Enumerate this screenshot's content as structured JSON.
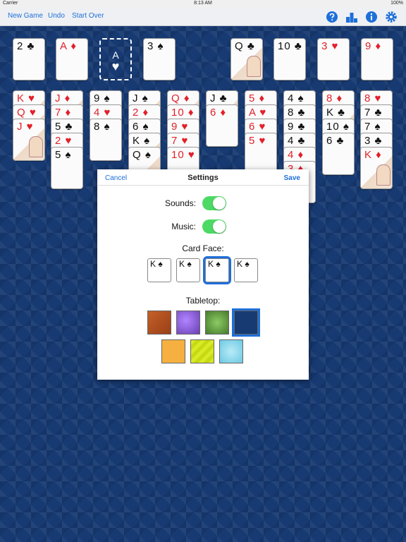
{
  "status": {
    "carrier": "Carrier",
    "time": "8:13 AM",
    "battery": "100%"
  },
  "toolbar": {
    "new_game": "New Game",
    "undo": "Undo",
    "start_over": "Start Over"
  },
  "top_cards": [
    "2 ♣",
    "A ♦",
    "3 ♠",
    "Q ♣",
    "10 ♣",
    "3 ♥",
    "9 ♦"
  ],
  "foundation_slot": {
    "rank": "A",
    "suit": "♥"
  },
  "col1": [
    "K ♥",
    "Q ♥",
    "J ♥"
  ],
  "col2": [
    "J ♦",
    "7 ♦",
    "5 ♣",
    "2 ♥",
    "5 ♠"
  ],
  "col3": [
    "9 ♠",
    "4 ♥",
    "8 ♠"
  ],
  "col4": [
    "J ♠",
    "2 ♦",
    "6 ♠",
    "K ♠",
    "Q ♠"
  ],
  "col5": [
    "Q ♦",
    "10 ♦",
    "9 ♥",
    "7 ♥",
    "10 ♥"
  ],
  "col6": [
    "J ♣",
    "6 ♦"
  ],
  "col7": [
    "5 ♦",
    "A ♥",
    "6 ♥",
    "5 ♥"
  ],
  "col8": [
    "4 ♠",
    "8 ♣",
    "9 ♣",
    "4 ♣",
    "4 ♦",
    "3 ♦"
  ],
  "col9": [
    "8 ♦",
    "K ♣",
    "10 ♠",
    "6 ♣"
  ],
  "col10": [
    "8 ♥",
    "7 ♣",
    "7 ♠",
    "3 ♣",
    "K ♦"
  ],
  "settings": {
    "cancel": "Cancel",
    "title": "Settings",
    "save": "Save",
    "sounds_label": "Sounds:",
    "music_label": "Music:",
    "card_face_label": "Card Face:",
    "card_face_options": [
      "K ♠",
      "K ♠",
      "K ♠",
      "K ♠"
    ],
    "tabletop_label": "Tabletop:",
    "sounds_on": true,
    "music_on": true,
    "selected_card_face": 3,
    "selected_tabletop": 4
  },
  "colors": {
    "accent": "#1e6fd9",
    "toggle_on": "#4cd964",
    "table_bg": "#173a72",
    "red_suit": "#e3202a"
  }
}
